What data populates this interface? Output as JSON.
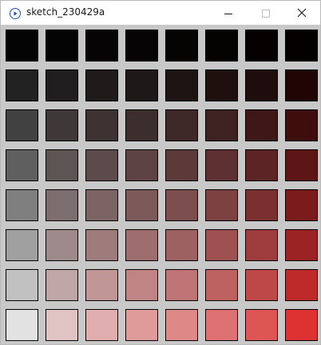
{
  "window": {
    "title": "sketch_230429a",
    "icons": {
      "app": "processing-play-icon",
      "minimize": "minimize-icon",
      "maximize": "maximize-icon",
      "close": "close-icon"
    }
  },
  "canvas": {
    "background": "#c8c8c8",
    "rows": 8,
    "cols": 8,
    "swatches": [
      [
        "#040404",
        "#050404",
        "#060404",
        "#060404",
        "#060303",
        "#050202",
        "#050101",
        "#050000"
      ],
      [
        "#222222",
        "#201e1e",
        "#201b1b",
        "#1f1818",
        "#1f1414",
        "#1f1010",
        "#1f0c0c",
        "#200505"
      ],
      [
        "#414141",
        "#3e3838",
        "#3e3232",
        "#3d2e2e",
        "#3e2828",
        "#3e2121",
        "#3e1818",
        "#3e0e0e"
      ],
      [
        "#5f5f5f",
        "#5d5454",
        "#5d4b4b",
        "#5d4343",
        "#5d3a3a",
        "#5d3131",
        "#5c2424",
        "#5d1515"
      ],
      [
        "#7f7f7f",
        "#7c6e6e",
        "#7c6464",
        "#7c5a5a",
        "#7c4e4e",
        "#7c4141",
        "#7b3030",
        "#7b1c1c"
      ],
      [
        "#a0a0a0",
        "#9e8a8a",
        "#9e7c7c",
        "#9e6e6e",
        "#9d6161",
        "#9d5151",
        "#9d3d3d",
        "#9c2323"
      ],
      [
        "#c1c1c1",
        "#c0a7a7",
        "#c09696",
        "#c08484",
        "#bf7575",
        "#be6161",
        "#be4848",
        "#be2a2a"
      ],
      [
        "#e2e2e2",
        "#e0c3c3",
        "#e0aeae",
        "#df9a9a",
        "#df8888",
        "#de7171",
        "#de5555",
        "#de3131"
      ]
    ]
  }
}
